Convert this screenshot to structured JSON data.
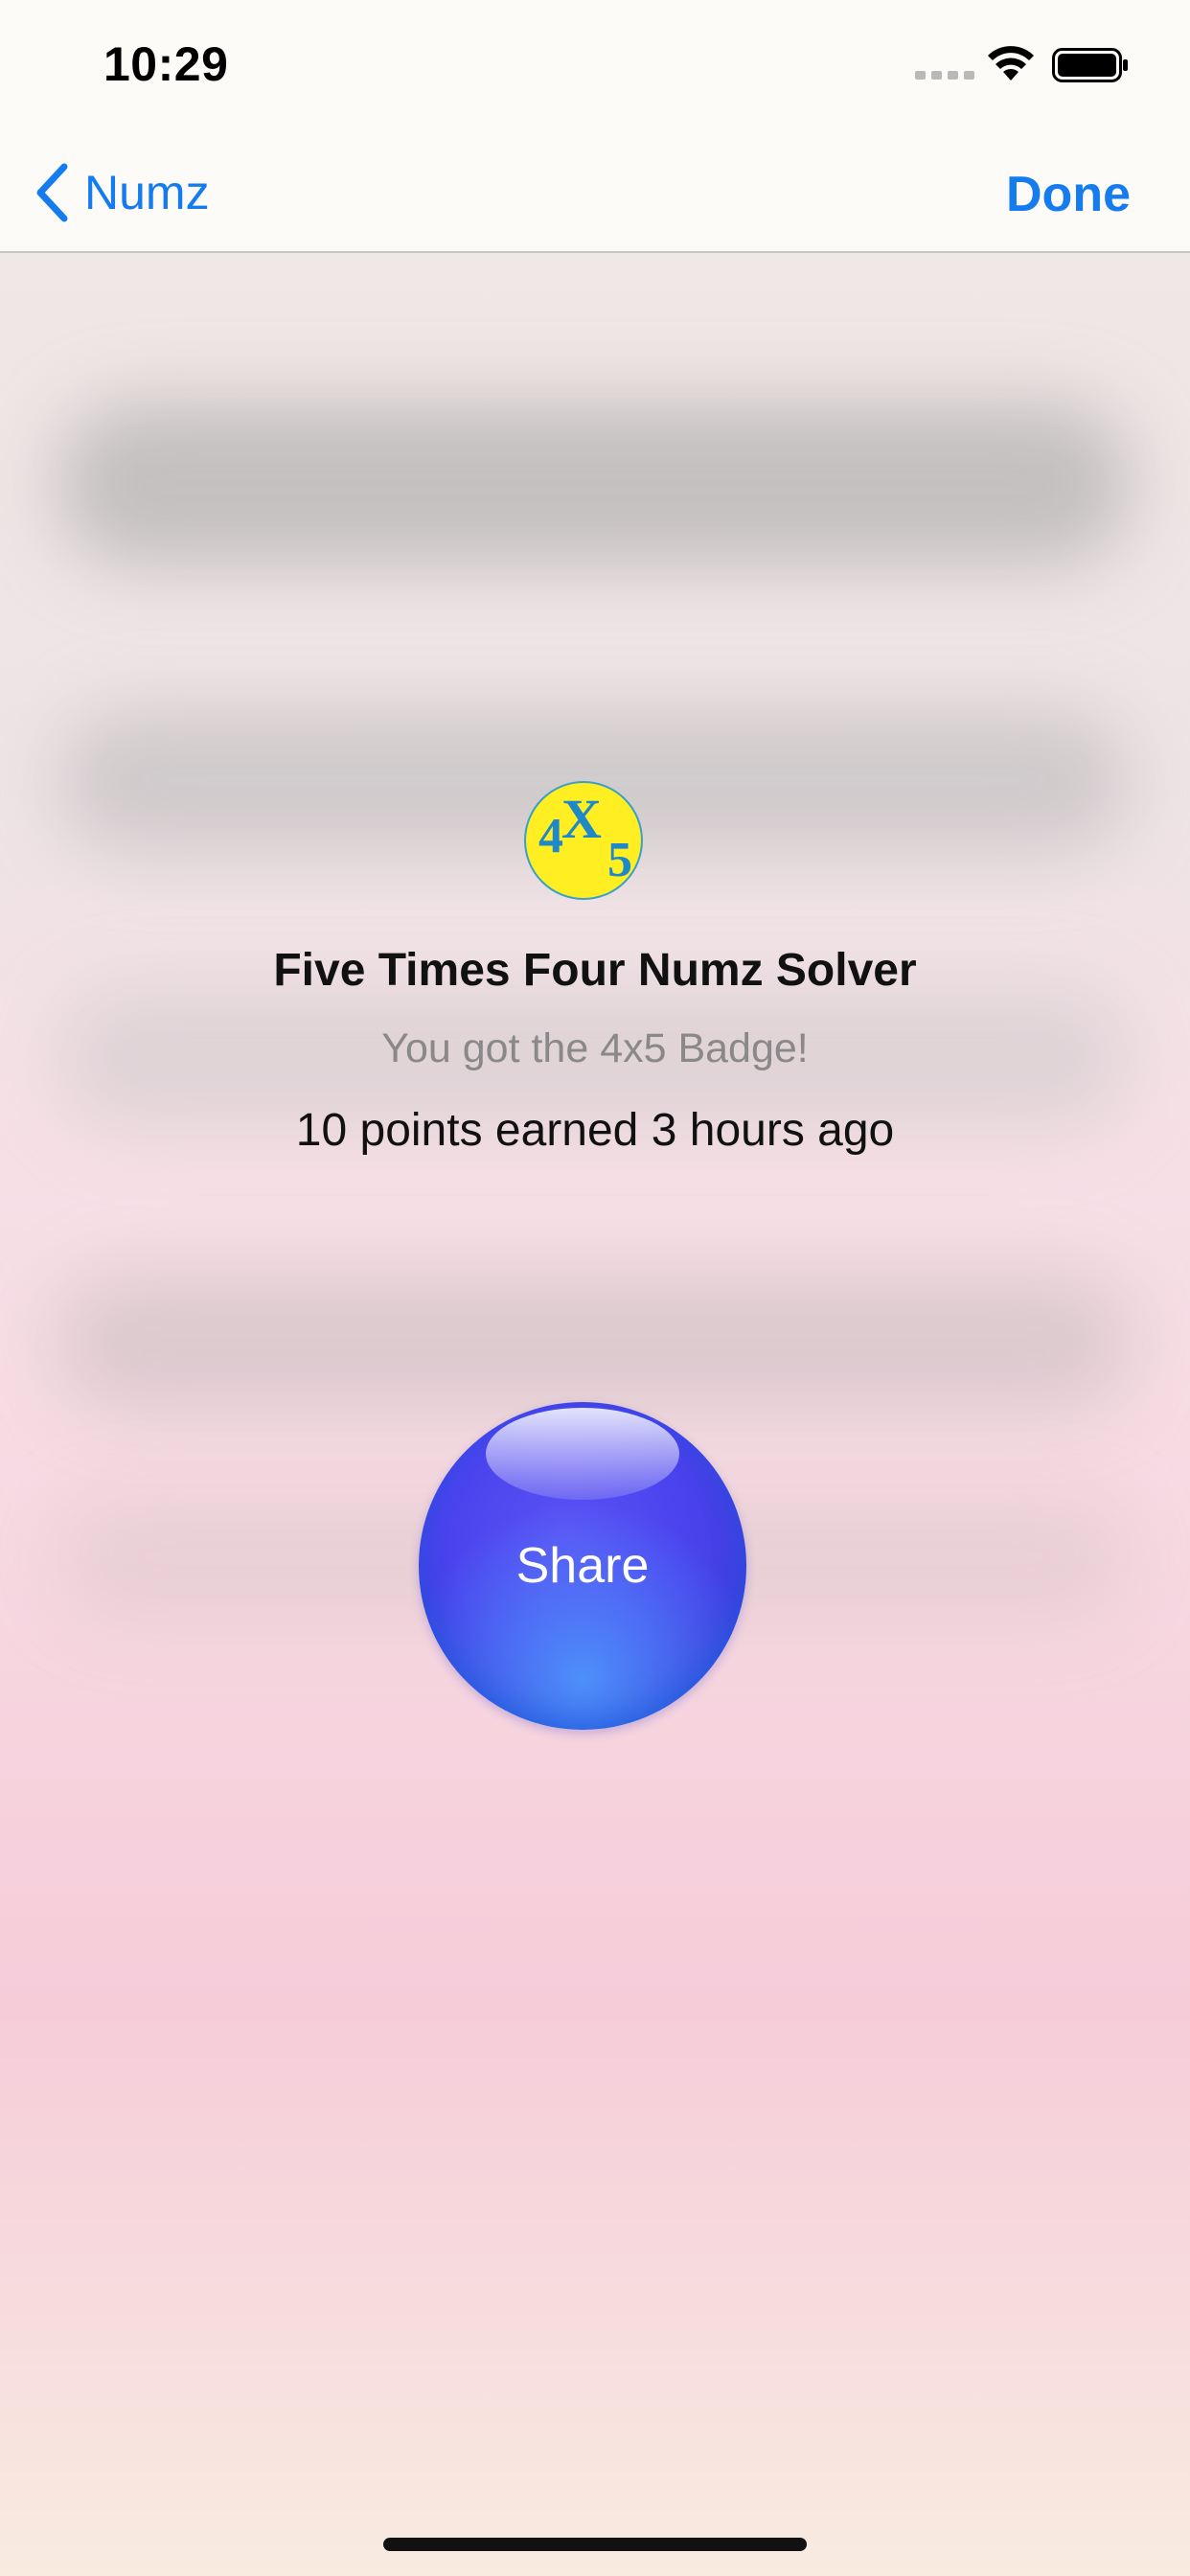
{
  "status_bar": {
    "time": "10:29"
  },
  "nav": {
    "back_label": "Numz",
    "done_label": "Done"
  },
  "badge": {
    "icon_text": {
      "four": "4",
      "times": "X",
      "five": "5"
    },
    "title": "Five Times Four Numz Solver",
    "subtitle": "You got the 4x5 Badge!",
    "points_text": "10 points earned 3 hours ago"
  },
  "share": {
    "label": "Share"
  },
  "colors": {
    "accent": "#157cf0",
    "orb": "#4a43ee",
    "badge_fill": "#ffee22",
    "badge_text": "#1e88c8"
  }
}
